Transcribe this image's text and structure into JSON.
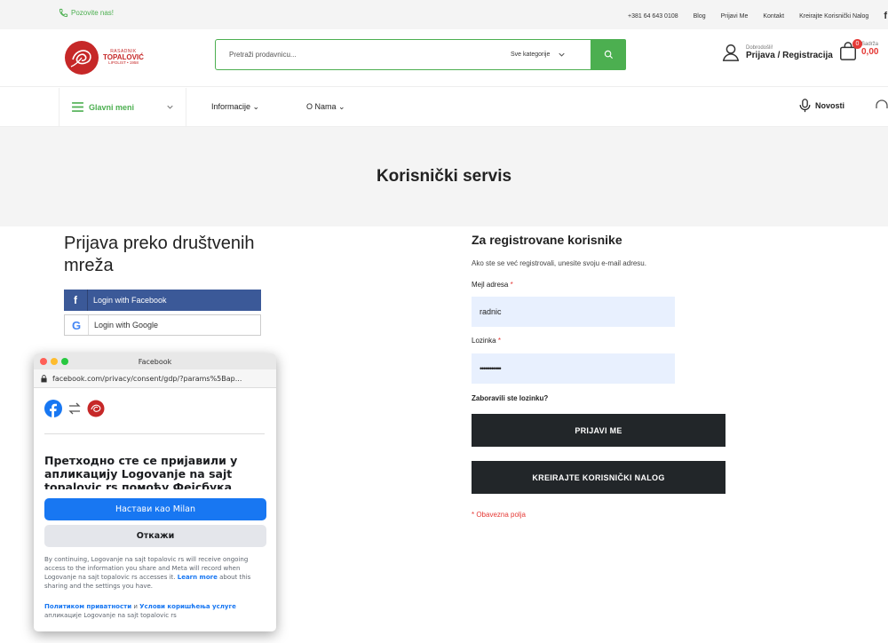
{
  "topbar": {
    "call_label": "Pozovite nas!",
    "phone": "+381 64 643 0108",
    "links": [
      "Blog",
      "Prijavi Me",
      "Kontakt",
      "Kreirajte Korisnički Nalog"
    ],
    "social_icon": "f"
  },
  "header": {
    "logo": {
      "line1": "RASADNIK",
      "line2": "TOPALOVIĆ",
      "line3": "LIPOLIST • 1958"
    },
    "search_placeholder": "Pretraži prodavnicu...",
    "category_select": "Sve kategorije",
    "greeting": "Dobrodošli!",
    "login_register": "Prijava / Registracija",
    "cart_count": "0",
    "cart_label": "Sadrža",
    "cart_amount": "0,00"
  },
  "nav": {
    "main_menu": "Glavni meni",
    "items": [
      "Informacije ⌄",
      "O Nama ⌄"
    ],
    "news": "Novosti"
  },
  "banner": {
    "title": "Korisnički servis"
  },
  "social_login": {
    "heading": "Prijava preko društvenih mreža",
    "facebook": "Login with Facebook",
    "google": "Login with Google"
  },
  "registered": {
    "heading": "Za registrovane korisnike",
    "subtitle": "Ako ste se već registrovali, unesite svoju e-mail adresu.",
    "email_label": "Mejl adresa",
    "email_value": "radnic",
    "password_label": "Lozinka",
    "password_value": "•••••••••••",
    "required_mark": "*",
    "forgot": "Zaboravili ste lozinku?",
    "login_button": "PRIJAVI ME",
    "create_button": "KREIRAJTE KORISNIČKI NALOG",
    "required_note": "* Obavezna polja"
  },
  "popup": {
    "window_title": "Facebook",
    "url": "facebook.com/privacy/consent/gdp/?params%5Bap...",
    "heading": "Претходно сте се пријавили у апликацију Logovanje na sajt topalovic rs помоћу Фејсбука",
    "continue_button": "Настави као Milan",
    "cancel_button": "Откажи",
    "fine_print": "By continuing, Logovanje na sajt topalovic rs will receive ongoing access to the information you share and Meta will record when Logovanje na sajt topalovic rs accesses it.",
    "learn_more": "Learn more",
    "fine_print_tail": "about this sharing and the settings you have.",
    "privacy_link": "Политиком приватности",
    "and": "и",
    "terms_link": "Услови коришћења услуге",
    "app_name_line": "апликације Logovanje na sajt topalovic rs"
  },
  "colors": {
    "accent": "#4caf50",
    "dark_button": "#222629",
    "facebook": "#3b5998",
    "fb_blue": "#1877f2",
    "required": "#e53935"
  }
}
